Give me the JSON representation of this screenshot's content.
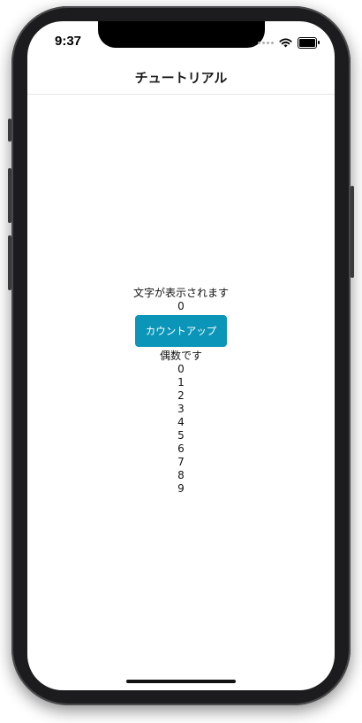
{
  "status_bar": {
    "time": "9:37"
  },
  "nav": {
    "title": "チュートリアル"
  },
  "main": {
    "message": "文字が表示されます",
    "counter": "0",
    "button_label": "カウントアップ",
    "parity_label": "偶数です",
    "numbers": [
      "0",
      "1",
      "2",
      "3",
      "4",
      "5",
      "6",
      "7",
      "8",
      "9"
    ]
  },
  "colors": {
    "button": "#0b95b8",
    "button_text": "#ffffff",
    "background": "#ffffff"
  },
  "icons": {
    "signal": "cellular-signal-icon",
    "wifi": "wifi-icon",
    "battery": "battery-icon"
  }
}
